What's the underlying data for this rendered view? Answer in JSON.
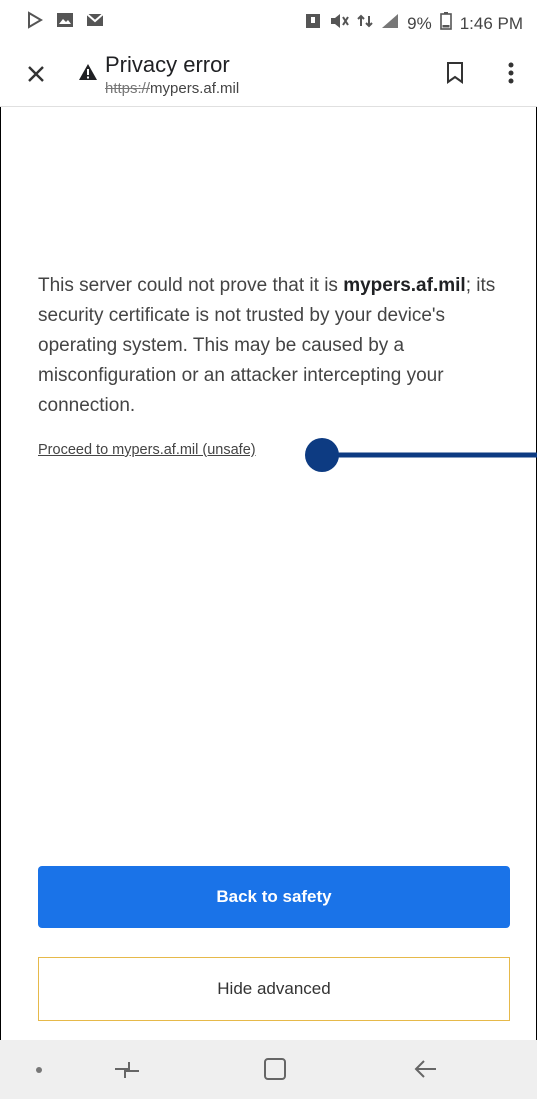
{
  "status_bar": {
    "time": "1:46 PM",
    "battery": "9%",
    "icons": [
      "play-store-icon",
      "gallery-icon",
      "mail-icon",
      "notification-icon",
      "mute-icon",
      "data-icon",
      "signal-icon",
      "battery-icon"
    ]
  },
  "toolbar": {
    "title": "Privacy error",
    "url_scheme": "https://",
    "url_host": "mypers.af.mil"
  },
  "content": {
    "message_part1": "This server could not prove that it is ",
    "message_bold": "mypers.af.mil",
    "message_part2": "; its security certificate is not trusted by your device's operating system. This may be caused by a misconfiguration or an attacker intercepting your connection.",
    "proceed_link": "Proceed to mypers.af.mil (unsafe)"
  },
  "buttons": {
    "primary": "Back to safety",
    "secondary": "Hide advanced"
  },
  "colors": {
    "primary_button": "#1a73e8",
    "pointer": "#0d3b82",
    "secondary_border": "#e6b94a"
  },
  "navigation": {
    "icons": [
      "nav-dot-icon",
      "recent-apps-icon",
      "home-icon",
      "back-icon"
    ]
  }
}
